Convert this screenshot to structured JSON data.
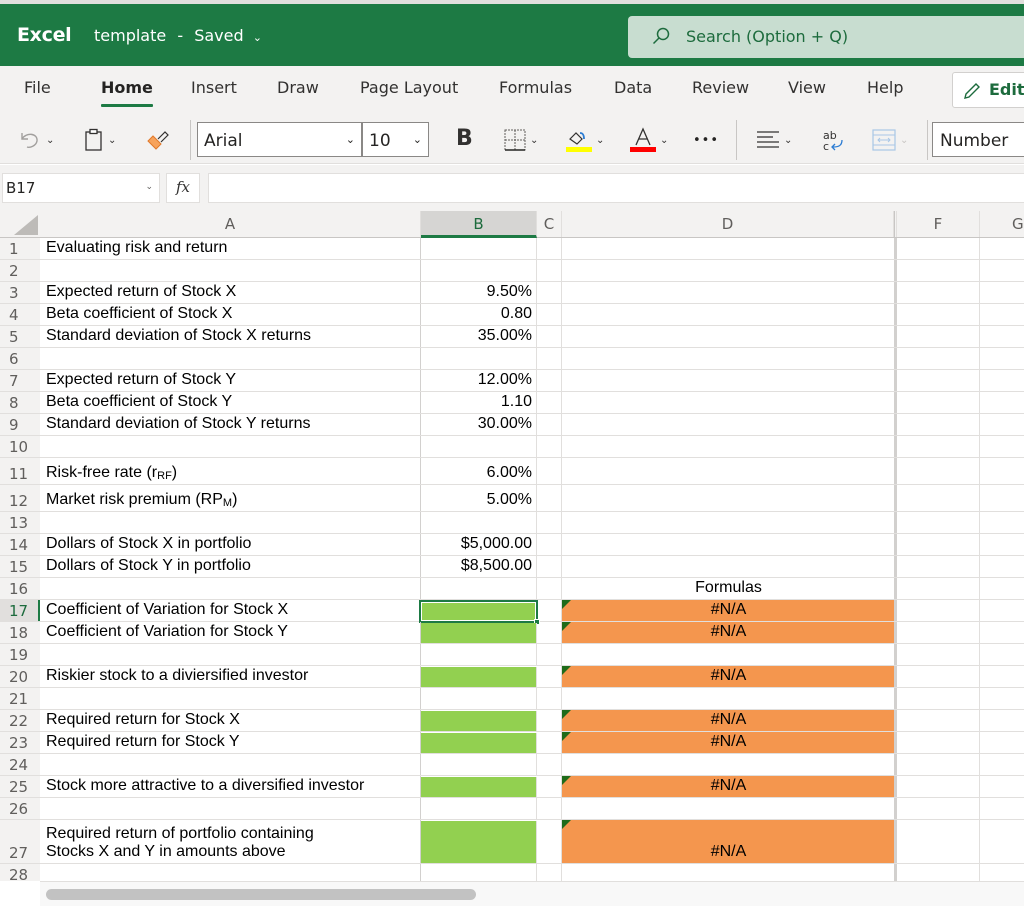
{
  "titlebar": {
    "app_name": "Excel",
    "doc_name": "template",
    "separator": "-",
    "save_status": "Saved",
    "search_placeholder": "Search (Option + Q)"
  },
  "ribbon": {
    "tabs": [
      {
        "label": "File",
        "active": false
      },
      {
        "label": "Home",
        "active": true
      },
      {
        "label": "Insert",
        "active": false
      },
      {
        "label": "Draw",
        "active": false
      },
      {
        "label": "Page Layout",
        "active": false
      },
      {
        "label": "Formulas",
        "active": false
      },
      {
        "label": "Data",
        "active": false
      },
      {
        "label": "Review",
        "active": false
      },
      {
        "label": "View",
        "active": false
      },
      {
        "label": "Help",
        "active": false
      }
    ],
    "editing_label": "Editing"
  },
  "toolbar": {
    "font_name": "Arial",
    "font_size": "10",
    "bold_label": "B",
    "more_label": "•••",
    "number_format": "Number",
    "colors": {
      "highlight": "#ffff00",
      "font_color": "#ff0000"
    }
  },
  "formula_bar": {
    "name_box": "B17",
    "fx_label": "fx",
    "formula": ""
  },
  "sheet": {
    "columns": [
      "A",
      "B",
      "C",
      "D",
      "F",
      "G"
    ],
    "selected_column": "B",
    "selected_cell": "B17",
    "colors": {
      "input_fill": "#92d050",
      "formula_fill": "#f4964e",
      "accent": "#1d7a44"
    },
    "rows": [
      {
        "n": "1",
        "a": "Evaluating risk and return",
        "b": "",
        "d": ""
      },
      {
        "n": "2",
        "a": "",
        "b": "",
        "d": ""
      },
      {
        "n": "3",
        "a": "Expected return of Stock X",
        "b": "9.50%",
        "d": ""
      },
      {
        "n": "4",
        "a": "Beta coefficient of Stock X",
        "b": "0.80",
        "d": ""
      },
      {
        "n": "5",
        "a": "Standard deviation of Stock X returns",
        "b": "35.00%",
        "d": ""
      },
      {
        "n": "6",
        "a": "",
        "b": "",
        "d": ""
      },
      {
        "n": "7",
        "a": "Expected return of Stock Y",
        "b": "12.00%",
        "d": ""
      },
      {
        "n": "8",
        "a": "Beta coefficient of Stock Y",
        "b": "1.10",
        "d": ""
      },
      {
        "n": "9",
        "a": "Standard deviation of Stock Y returns",
        "b": "30.00%",
        "d": ""
      },
      {
        "n": "10",
        "a": "",
        "b": "",
        "d": ""
      },
      {
        "n": "11",
        "a": "Risk-free rate (r",
        "a_sub": "RF",
        "a_tail": ")",
        "b": "6.00%",
        "d": ""
      },
      {
        "n": "12",
        "a": "Market risk premium (RP",
        "a_sub": "M",
        "a_tail": ")",
        "b": "5.00%",
        "d": ""
      },
      {
        "n": "13",
        "a": "",
        "b": "",
        "d": ""
      },
      {
        "n": "14",
        "a": "Dollars of Stock X in portfolio",
        "b": "$5,000.00",
        "d": ""
      },
      {
        "n": "15",
        "a": "Dollars of Stock Y in portfolio",
        "b": "$8,500.00",
        "d": ""
      },
      {
        "n": "16",
        "a": "",
        "b": "",
        "d": "Formulas"
      },
      {
        "n": "17",
        "a": "Coefficient of Variation for Stock X",
        "b": "",
        "d": "#N/A"
      },
      {
        "n": "18",
        "a": "Coefficient of Variation for Stock Y",
        "b": "",
        "d": "#N/A"
      },
      {
        "n": "19",
        "a": "",
        "b": "",
        "d": ""
      },
      {
        "n": "20",
        "a": "Riskier stock to a diviersified investor",
        "b": "",
        "d": "#N/A"
      },
      {
        "n": "21",
        "a": "",
        "b": "",
        "d": ""
      },
      {
        "n": "22",
        "a": "Required return for Stock X",
        "b": "",
        "d": "#N/A"
      },
      {
        "n": "23",
        "a": "Required return for Stock Y",
        "b": "",
        "d": "#N/A"
      },
      {
        "n": "24",
        "a": "",
        "b": "",
        "d": ""
      },
      {
        "n": "25",
        "a": "Stock more attractive to a diversified investor",
        "b": "",
        "d": "#N/A"
      },
      {
        "n": "26",
        "a": "",
        "b": "",
        "d": ""
      },
      {
        "n": "27",
        "a": "Required return of portfolio containing\nStocks X and Y in amounts above",
        "b": "",
        "d": "#N/A"
      },
      {
        "n": "28",
        "a": "",
        "b": "",
        "d": ""
      }
    ]
  }
}
